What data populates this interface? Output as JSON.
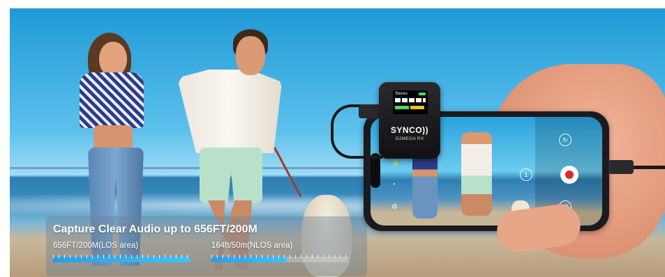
{
  "banner": {
    "headline": "Capture Clear Audio up to 656FT/200M",
    "ranges": [
      {
        "label": "656FT/200M(LOS area)",
        "fill": 1.0,
        "color": "#2a9ee8"
      },
      {
        "label": "164ft/50m(NLOS area)",
        "fill": 0.55,
        "color": "#2a9ee8"
      }
    ]
  },
  "receiver": {
    "brand": "SYNCO",
    "model": "G2MEGA RX",
    "screen": {
      "mode": "Stereo"
    }
  },
  "phone_camera": {
    "record_color": "#e4262c",
    "icons": [
      "flip-camera-icon",
      "record-icon",
      "gallery-icon",
      "speed-icon",
      "flash-icon",
      "settings-icon"
    ]
  },
  "colors": {
    "accent": "#2a9ee8",
    "record": "#e4262c",
    "device": "#111114"
  }
}
